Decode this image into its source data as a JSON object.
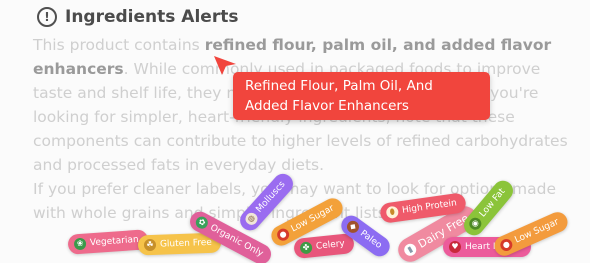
{
  "header": {
    "icon": "exclamation-circle-icon",
    "title": "Ingredients Alerts"
  },
  "body": {
    "intro": "This product contains ",
    "highlight": "refined flour, palm oil, and added flavor enhancers",
    "rest": ". While commonly used in packaged foods to improve taste and shelf life, they may not suit everyone's needs. If you're looking for simpler, heart-friendly ingredients, note that these components can contribute to higher levels of refined carbohydrates and processed fats in everyday diets.",
    "second": "If you prefer cleaner labels, you may want to look for options made with whole grains and simpler ingredient lists."
  },
  "tooltip": {
    "text": "Refined Flour, Palm Oil, And Added Flavor Enhancers",
    "color": "#f1453d"
  },
  "tags": [
    {
      "label": "Vegetarian",
      "icon": "broccoli-icon",
      "color": "#ee6b8c"
    },
    {
      "label": "Gluten Free",
      "icon": "wheat-icon",
      "color": "#f6c34a"
    },
    {
      "label": "Organic Only",
      "icon": "leaf-icon",
      "color": "#e0609a"
    },
    {
      "label": "Molluscs",
      "icon": "shell-icon",
      "color": "#9a6cf0"
    },
    {
      "label": "Low Sugar",
      "icon": "apple-icon",
      "color": "#f3a13a"
    },
    {
      "label": "Celery",
      "icon": "celery-icon",
      "color": "#e8567b"
    },
    {
      "label": "Paleo",
      "icon": "meat-icon",
      "color": "#8c6cf2"
    },
    {
      "label": "Dairy Free",
      "icon": "milk-icon",
      "color": "#f08aa0"
    },
    {
      "label": "High Protein",
      "icon": "egg-icon",
      "color": "#ef5a6a"
    },
    {
      "label": "Heart Health",
      "icon": "heart-icon",
      "color": "#ec5b9b"
    },
    {
      "label": "Low Fat",
      "icon": "avocado-icon",
      "color": "#8bc43a"
    },
    {
      "label": "Low Sugar",
      "icon": "apple-icon",
      "color": "#f39b3d"
    }
  ]
}
